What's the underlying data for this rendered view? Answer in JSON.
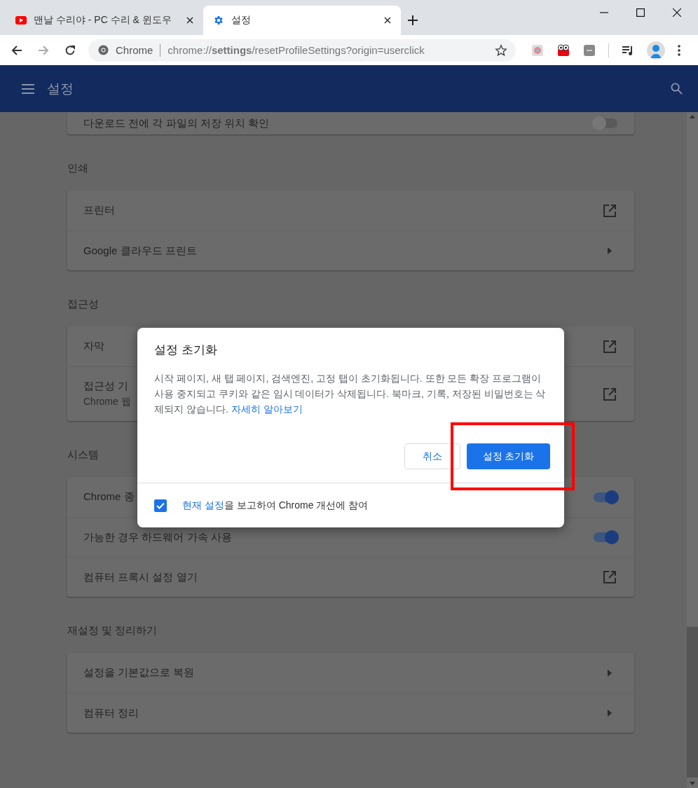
{
  "tabs": [
    {
      "title": "맨날 수리야 - PC 수리 & 윈도우",
      "kind": "video",
      "selected": false
    },
    {
      "title": "설정",
      "kind": "gear",
      "selected": true
    }
  ],
  "omnibox": {
    "site_label": "Chrome",
    "url": "chrome://**settings**/resetProfileSettings?origin=userclick"
  },
  "header": {
    "title": "설정"
  },
  "sections": [
    {
      "rows": [
        {
          "label": "다운로드 전에 각 파일의 저장 위치 확인",
          "kind": "toggle",
          "on": false
        }
      ]
    },
    {
      "title": "인쇄",
      "rows": [
        {
          "label": "프린터",
          "kind": "external"
        },
        {
          "label": "Google 클라우드 프린트",
          "kind": "arrow"
        }
      ]
    },
    {
      "title": "접근성",
      "rows": [
        {
          "label": "자막",
          "kind": "external"
        },
        {
          "label": "접근성 기",
          "sublabel": "Chrome 웹",
          "kind": "external"
        }
      ]
    },
    {
      "title": "시스템",
      "rows": [
        {
          "label": "Chrome 종",
          "kind": "toggle",
          "on": true
        },
        {
          "label": "가능한 경우 하드웨어 가속 사용",
          "kind": "toggle",
          "on": true
        },
        {
          "label": "컴퓨터 프록시 설정 열기",
          "kind": "external"
        }
      ]
    },
    {
      "title": "재설정 및 정리하기",
      "rows": [
        {
          "label": "설정을 기본값으로 복원",
          "kind": "arrow"
        },
        {
          "label": "컴퓨터 정리",
          "kind": "arrow"
        }
      ]
    }
  ],
  "dialog": {
    "title": "설정 초기화",
    "body": "시작 페이지, 새 탭 페이지, 검색엔진, 고정 탭이 초기화됩니다. 또한 모든 확장 프로그램이 사용 중지되고 쿠키와 같은 임시 데이터가 삭제됩니다. 북마크, 기록, 저장된 비밀번호는 삭제되지 않습니다.",
    "link": "자세히 알아보기",
    "buttons": [
      {
        "label": "취소",
        "kind": "secondary"
      },
      {
        "label": "설정 초기화",
        "kind": "primary"
      }
    ],
    "footer": {
      "checked": true,
      "link": "현재 설정",
      "text": "을 보고하여 Chrome 개선에 참여"
    }
  }
}
